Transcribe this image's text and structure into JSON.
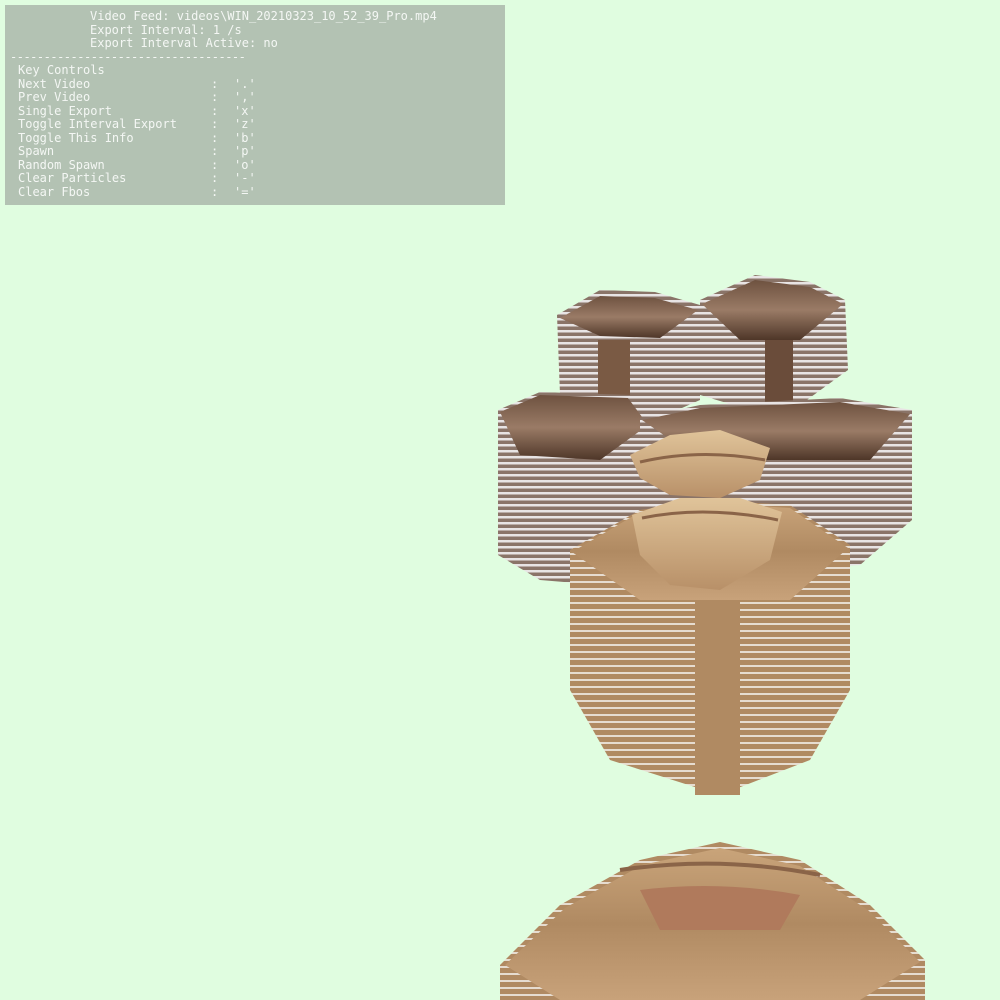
{
  "info": {
    "video_feed_label": "Video Feed:",
    "video_feed_value": "videos\\WIN_20210323_10_52_39_Pro.mp4",
    "export_interval_label": "Export Interval:",
    "export_interval_value": "1 /s",
    "export_active_label": "Export Interval Active:",
    "export_active_value": "no",
    "separator": "-----------------------------------",
    "controls_title": "Key Controls",
    "controls": [
      {
        "label": "Next Video",
        "key": "'.'"
      },
      {
        "label": "Prev Video",
        "key": "','"
      },
      {
        "label": "Single Export",
        "key": "'x'"
      },
      {
        "label": "Toggle Interval Export",
        "key": "'z'"
      },
      {
        "label": "Toggle This Info",
        "key": "'b'"
      },
      {
        "label": "Spawn",
        "key": "'p'"
      },
      {
        "label": "Random Spawn",
        "key": "'o'"
      },
      {
        "label": "Clear Particles",
        "key": "'-'"
      },
      {
        "label": "Clear Fbos",
        "key": "'='"
      }
    ],
    "colon": ":"
  },
  "colors": {
    "background": "#e0fde0",
    "panel": "#b3c2b3",
    "panel_text": "#f4f7f4",
    "skin_light": "#d8b88c",
    "skin_mid": "#b89068",
    "skin_dark": "#8c6a4a",
    "brown_dark": "#5a4030",
    "stripe_light": "#e6e2e2"
  }
}
